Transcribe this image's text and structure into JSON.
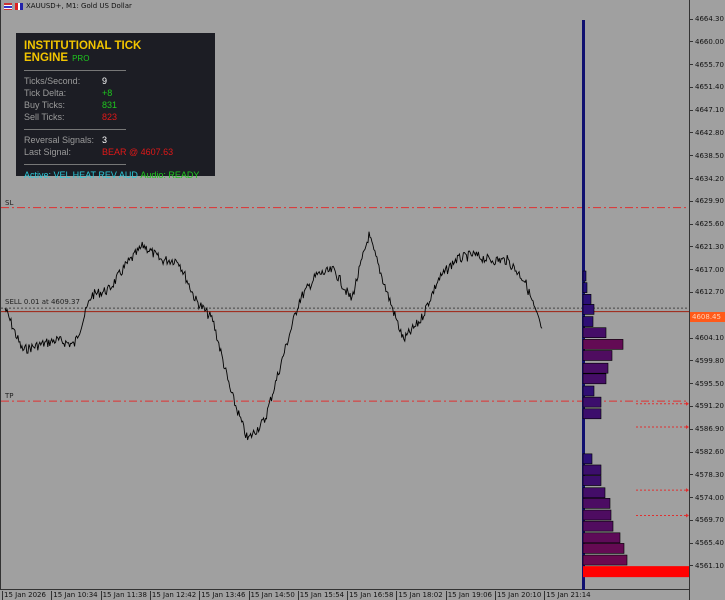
{
  "window": {
    "title": "XAUUSD+, M1:  Gold US Dollar"
  },
  "panel": {
    "title": "INSTITUTIONAL TICK ENGINE",
    "badge": "PRO",
    "rows1": [
      {
        "label": "Ticks/Second:",
        "value": "9"
      },
      {
        "label": "Tick Delta:",
        "value": "+8"
      },
      {
        "label": "Buy Ticks:",
        "value": "831"
      },
      {
        "label": "Sell Ticks:",
        "value": "823"
      }
    ],
    "rows2": [
      {
        "label": "Reversal Signals:",
        "value": "3"
      },
      {
        "label": "Last Signal:",
        "value": "BEAR @ 4607.63"
      }
    ],
    "active": "Active: VEL HEAT REV AUD",
    "audio": "Audio: READY"
  },
  "levels": {
    "sl": "SL",
    "tp": "TP",
    "order": "SELL 0.01 at 4609.37",
    "sl_price": 4628.9,
    "tp_price": 4592.4,
    "order_price": 4609.37,
    "current_price": "4608.45"
  },
  "colors": {
    "level": "#e03030",
    "current": "#ff5a1a",
    "bar_low": "#1c1080",
    "bar_high": "#6a0a50",
    "bar_max": "#ff0000"
  },
  "price_axis": [
    "4664.30",
    "4660.00",
    "4655.70",
    "4651.40",
    "4647.10",
    "4642.80",
    "4638.50",
    "4634.20",
    "4629.90",
    "4625.60",
    "4621.30",
    "4617.00",
    "4612.70",
    "4604.10",
    "4599.80",
    "4595.50",
    "4591.20",
    "4586.90",
    "4582.60",
    "4578.30",
    "4574.00",
    "4569.70",
    "4565.40",
    "4561.10"
  ],
  "time_axis": [
    "15 Jan 2026",
    "15 Jan 10:34",
    "15 Jan 11:38",
    "15 Jan 12:42",
    "15 Jan 13:46",
    "15 Jan 14:50",
    "15 Jan 15:54",
    "15 Jan 16:58",
    "15 Jan 18:02",
    "15 Jan 19:06",
    "15 Jan 20:10",
    "15 Jan 21:14"
  ],
  "price_series": [
    4609.9,
    4602.0,
    4603.0,
    4603.9,
    4603.0,
    4612.4,
    4613.4,
    4618.1,
    4621.8,
    4619.0,
    4619.0,
    4611.5,
    4607.7,
    4594.5,
    4585.1,
    4588.8,
    4600.2,
    4611.5,
    4616.2,
    4617.1,
    4611.5,
    4623.7,
    4613.4,
    4603.9,
    4607.7,
    4615.2,
    4619.0,
    4620.0,
    4619.0,
    4619.0,
    4615.2,
    4605.8
  ],
  "volume_profile": [
    {
      "price": 4560.5,
      "volume": 100
    },
    {
      "price": 4562.4,
      "volume": 44
    },
    {
      "price": 4564.6,
      "volume": 41
    },
    {
      "price": 4566.6,
      "volume": 37
    },
    {
      "price": 4568.8,
      "volume": 30
    },
    {
      "price": 4570.9,
      "volume": 28
    },
    {
      "price": 4573.1,
      "volume": 27
    },
    {
      "price": 4575.1,
      "volume": 22
    },
    {
      "price": 4577.4,
      "volume": 18
    },
    {
      "price": 4579.4,
      "volume": 18
    },
    {
      "price": 4581.5,
      "volume": 9
    },
    {
      "price": 4590.0,
      "volume": 18
    },
    {
      "price": 4592.2,
      "volume": 18
    },
    {
      "price": 4594.3,
      "volume": 11
    },
    {
      "price": 4596.6,
      "volume": 23
    },
    {
      "price": 4598.6,
      "volume": 25
    },
    {
      "price": 4601.0,
      "volume": 29
    },
    {
      "price": 4603.1,
      "volume": 40
    },
    {
      "price": 4605.3,
      "volume": 23
    },
    {
      "price": 4607.4,
      "volume": 10
    },
    {
      "price": 4609.7,
      "volume": 11
    },
    {
      "price": 4611.6,
      "volume": 8
    },
    {
      "price": 4613.8,
      "volume": 4
    },
    {
      "price": 4616.0,
      "volume": 3
    }
  ],
  "order_arrows": [
    4591.9,
    4587.5,
    4575.6,
    4570.8
  ]
}
